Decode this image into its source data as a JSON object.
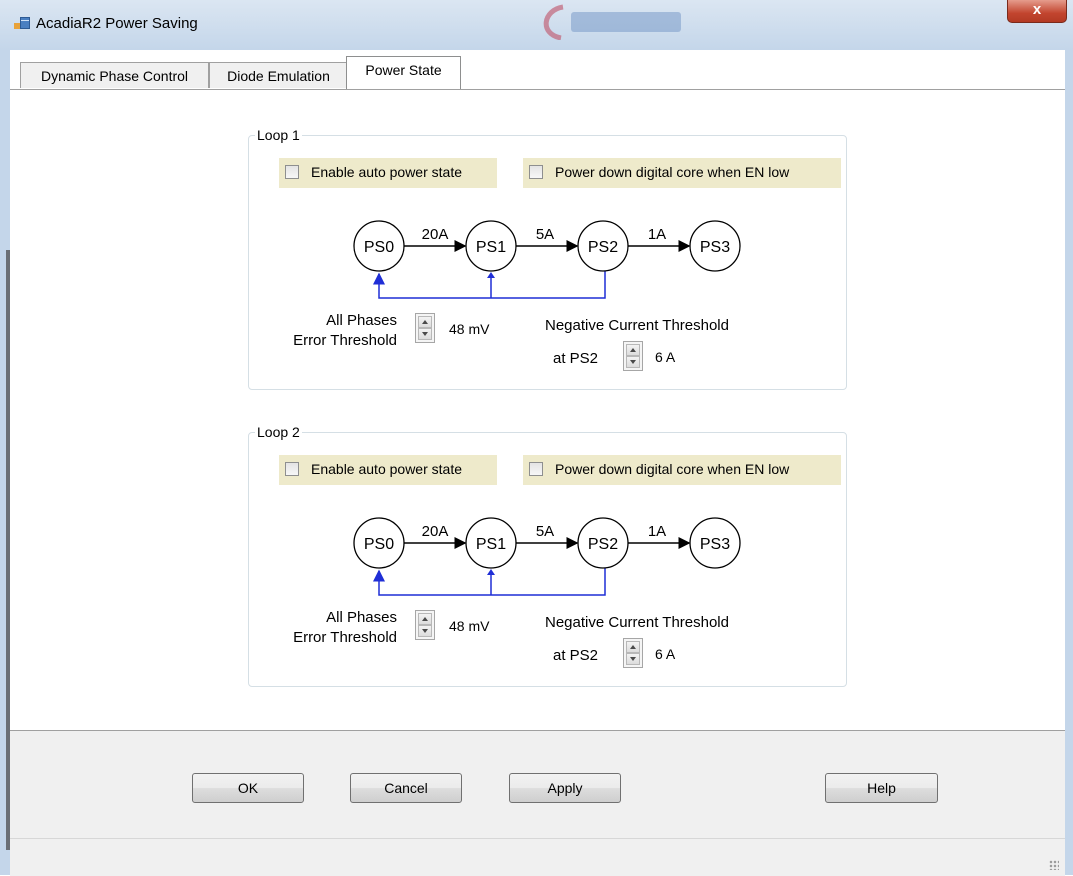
{
  "window": {
    "title": "AcadiaR2 Power Saving",
    "close_label": "x"
  },
  "tabs": [
    {
      "label": "Dynamic Phase Control"
    },
    {
      "label": "Diode Emulation"
    },
    {
      "label": "Power State"
    }
  ],
  "active_tab": "Power State",
  "loops": [
    {
      "group_label": "Loop 1",
      "auto_power_state": {
        "label": "Enable auto power state",
        "checked": false
      },
      "power_down_core": {
        "label": "Power down digital core when EN low",
        "checked": false
      },
      "states": [
        "PS0",
        "PS1",
        "PS2",
        "PS3"
      ],
      "transitions": [
        "20A",
        "5A",
        "1A"
      ],
      "error_threshold": {
        "label_line1": "All Phases",
        "label_line2": "Error Threshold",
        "value": "48 mV"
      },
      "neg_current_threshold": {
        "label": "Negative Current Threshold",
        "sub_label": "at PS2",
        "value": "6 A"
      }
    },
    {
      "group_label": "Loop 2",
      "auto_power_state": {
        "label": "Enable auto power state",
        "checked": false
      },
      "power_down_core": {
        "label": "Power down digital core when EN low",
        "checked": false
      },
      "states": [
        "PS0",
        "PS1",
        "PS2",
        "PS3"
      ],
      "transitions": [
        "20A",
        "5A",
        "1A"
      ],
      "error_threshold": {
        "label_line1": "All Phases",
        "label_line2": "Error Threshold",
        "value": "48 mV"
      },
      "neg_current_threshold": {
        "label": "Negative Current Threshold",
        "sub_label": "at PS2",
        "value": "6 A"
      }
    }
  ],
  "buttons": {
    "ok": "OK",
    "cancel": "Cancel",
    "apply": "Apply",
    "help": "Help"
  },
  "colors": {
    "checkbox_highlight": "#eeeacb",
    "feedback_arrow": "#1f2ed6",
    "close_button": "#c2452f"
  }
}
